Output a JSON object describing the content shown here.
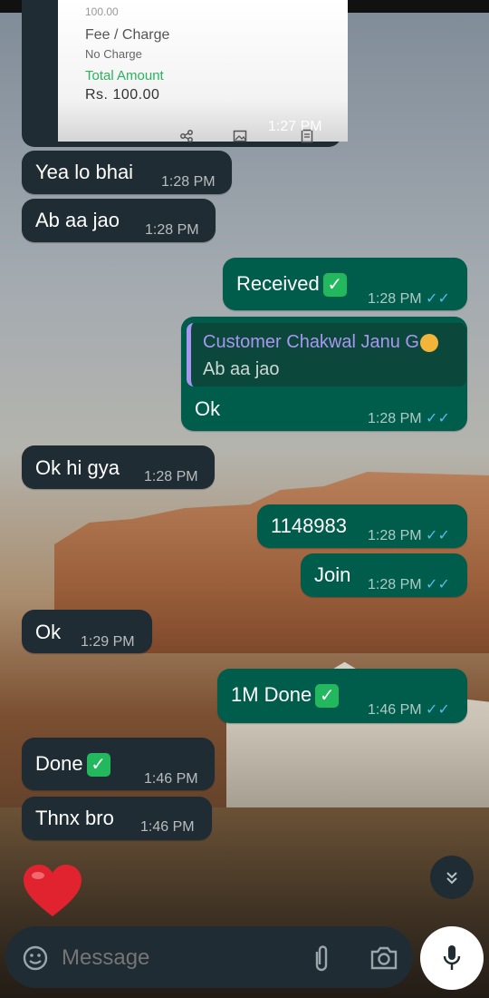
{
  "receipt": {
    "faint_top": "100.00",
    "fee_label": "Fee / Charge",
    "fee_value": "No Charge",
    "total_label": "Total Amount",
    "total_value": "Rs. 100.00",
    "time": "1:27 PM"
  },
  "messages": [
    {
      "dir": "in",
      "text": "Yea lo bhai",
      "time": "1:28 PM"
    },
    {
      "dir": "in",
      "text": "Ab aa jao",
      "time": "1:28 PM"
    },
    {
      "dir": "out",
      "text": "Received",
      "time": "1:28 PM"
    },
    {
      "dir": "out",
      "quote_author": "Customer Chakwal Janu G",
      "quote_text": "Ab aa jao",
      "text": "Ok",
      "time": "1:28 PM"
    },
    {
      "dir": "in",
      "text": "Ok hi gya",
      "time": "1:28 PM"
    },
    {
      "dir": "out",
      "text": "1148983",
      "time": "1:28 PM"
    },
    {
      "dir": "out",
      "text": "Join",
      "time": "1:28 PM"
    },
    {
      "dir": "in",
      "text": "Ok",
      "time": "1:29 PM"
    },
    {
      "dir": "out",
      "text": "1M Done",
      "time": "1:46 PM"
    },
    {
      "dir": "in",
      "text": "Done",
      "time": "1:46 PM"
    },
    {
      "dir": "in",
      "text": "Thnx bro",
      "time": "1:46 PM"
    }
  ],
  "composer": {
    "placeholder": "Message"
  },
  "colors": {
    "incoming": "#1f2c33",
    "outgoing": "#005c4b",
    "read_ticks": "#53bdeb"
  },
  "icons": [
    "share-icon",
    "image-icon",
    "document-icon",
    "double-check-icon",
    "check-emoji-icon",
    "emoji-icon",
    "attach-icon",
    "camera-icon",
    "mic-icon",
    "scroll-down-icon",
    "heart-icon"
  ]
}
